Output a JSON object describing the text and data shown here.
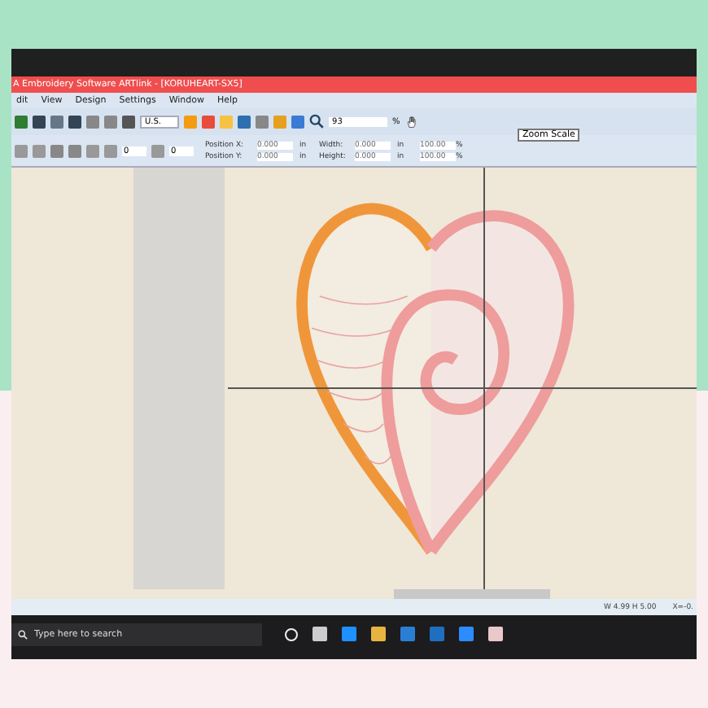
{
  "window": {
    "title": "A Embroidery Software ARTlink - [KORUHEART-SX5]"
  },
  "menu": [
    "dit",
    "View",
    "Design",
    "Settings",
    "Window",
    "Help"
  ],
  "toolbar": {
    "unit": "U.S.",
    "zoom_value": "93",
    "zoom_unit": "%",
    "tooltip": "Zoom Scale"
  },
  "transform": {
    "rotate": "0",
    "slant": "0",
    "fields": [
      {
        "label": "Position X:",
        "value": "0.000",
        "unit": "in",
        "label2": "Width:",
        "value2": "0.000",
        "unit2": "in",
        "scale": "100.00",
        "scale_unit": "%"
      },
      {
        "label": "Position Y:",
        "value": "0.000",
        "unit": "in",
        "label2": "Height:",
        "value2": "0.000",
        "unit2": "in",
        "scale": "100.00",
        "scale_unit": "%"
      }
    ]
  },
  "status_bar": [
    "W 4.99 H 5.00",
    "X=-0."
  ],
  "taskbar": {
    "search_placeholder": "Type here to search"
  }
}
